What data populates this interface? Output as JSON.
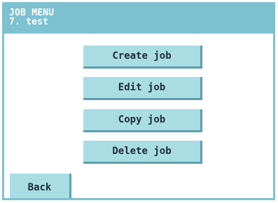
{
  "header": {
    "title": "JOB MENU",
    "subtitle": "7. test"
  },
  "menu": {
    "items": [
      {
        "label": "Create job"
      },
      {
        "label": "Edit job"
      },
      {
        "label": "Copy job"
      },
      {
        "label": "Delete job"
      }
    ]
  },
  "footer": {
    "back_label": "Back"
  },
  "colors": {
    "header_bg": "#7ec1d1",
    "button_bg": "#a8dde4",
    "button_shadow": "#5c9fae",
    "text": "#222a3a"
  }
}
